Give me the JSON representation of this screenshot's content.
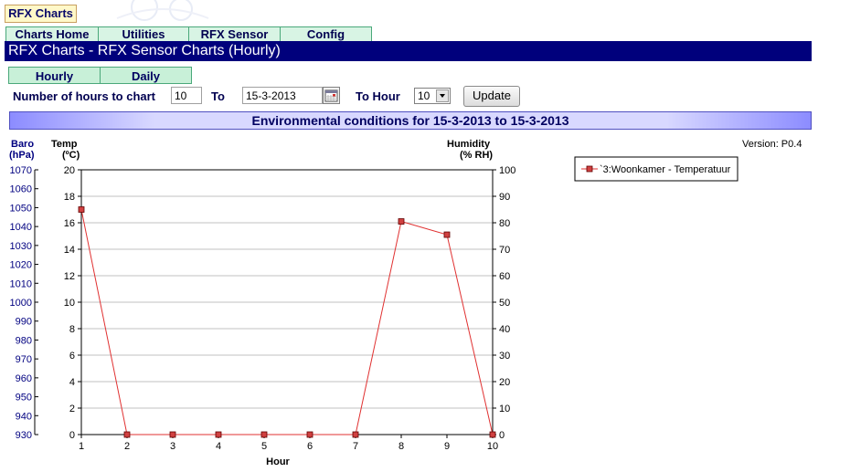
{
  "app": {
    "logo_text": "RFX Charts"
  },
  "nav": {
    "tabs": [
      {
        "label": "Charts Home"
      },
      {
        "label": "Utilities"
      },
      {
        "label": "RFX Sensor"
      },
      {
        "label": "Config"
      }
    ]
  },
  "page": {
    "title": "RFX Charts - RFX Sensor Charts (Hourly)"
  },
  "subtabs": [
    {
      "label": "Hourly"
    },
    {
      "label": "Daily"
    }
  ],
  "form": {
    "hours_label": "Number of hours to chart",
    "hours_value": "10",
    "to_label": "To",
    "date_value": "15-3-2013",
    "to_hour_label": "To Hour",
    "to_hour_value": "10",
    "update_label": "Update"
  },
  "section": {
    "title": "Environmental conditions for  15-3-2013 to 15-3-2013"
  },
  "version": "Version: P0.4",
  "colors": {
    "series": "#e03030",
    "marker_fill": "#d04040",
    "title_bar": "#00007c"
  },
  "chart_data": {
    "type": "line",
    "xlabel": "Hour",
    "x": [
      1,
      2,
      3,
      4,
      5,
      6,
      7,
      8,
      9,
      10
    ],
    "xlim": [
      1,
      10
    ],
    "series": [
      {
        "name": "`3:Woonkamer - Temperatuur",
        "axis": "temp",
        "values": [
          17.0,
          0,
          0,
          0,
          0,
          0,
          0,
          16.1,
          15.1,
          0
        ]
      }
    ],
    "axes": {
      "baro": {
        "label_line1": "Baro",
        "label_line2": "(hPa)",
        "lim": [
          930,
          1070
        ],
        "ticks": [
          "1070",
          "1060",
          "1050",
          "1040",
          "1030",
          "1020",
          "1010",
          "1000",
          "990",
          "980",
          "970",
          "960",
          "950",
          "940",
          "930"
        ]
      },
      "temp": {
        "label_line1": "Temp",
        "label_line2": "(ºC)",
        "lim": [
          0,
          20
        ],
        "ticks": [
          "20",
          "18",
          "16",
          "14",
          "12",
          "10",
          "8",
          "6",
          "4",
          "2",
          "0"
        ]
      },
      "humidity": {
        "label_line1": "Humidity",
        "label_line2": "(% RH)",
        "lim": [
          0,
          100
        ],
        "ticks": [
          "100",
          "90",
          "80",
          "70",
          "60",
          "50",
          "40",
          "30",
          "20",
          "10",
          "0"
        ]
      }
    },
    "xticks": [
      "1",
      "2",
      "3",
      "4",
      "5",
      "6",
      "7",
      "8",
      "9",
      "10"
    ],
    "grid": true,
    "legend_position": "right"
  }
}
